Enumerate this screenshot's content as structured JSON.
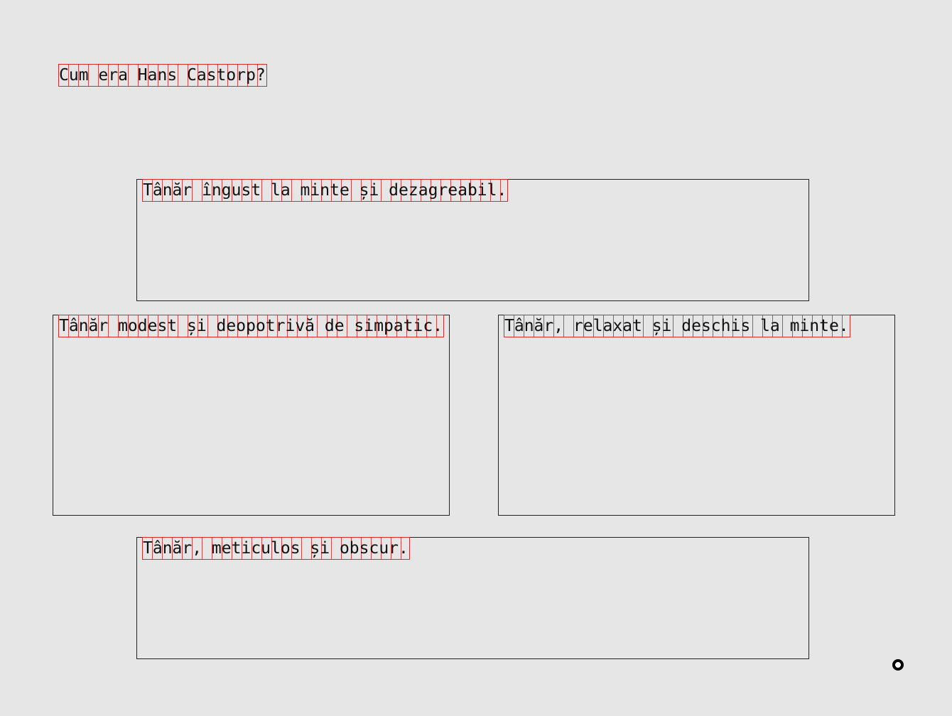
{
  "question": {
    "text": "Cum era Hans Castorp?"
  },
  "options": [
    {
      "text": "Tânăr îngust la minte și dezagreabil."
    },
    {
      "text": "Tânăr modest și deopotrivă de simpatic."
    },
    {
      "text": "Tânăr, relaxat și deschis la minte."
    },
    {
      "text": "Tânăr, meticulos și obscur."
    }
  ],
  "cursor": {
    "icon": "circle-cursor-icon"
  },
  "colors": {
    "background": "#e6e6e6",
    "border": "#222222",
    "grid_overlay": "#d42a2a"
  }
}
